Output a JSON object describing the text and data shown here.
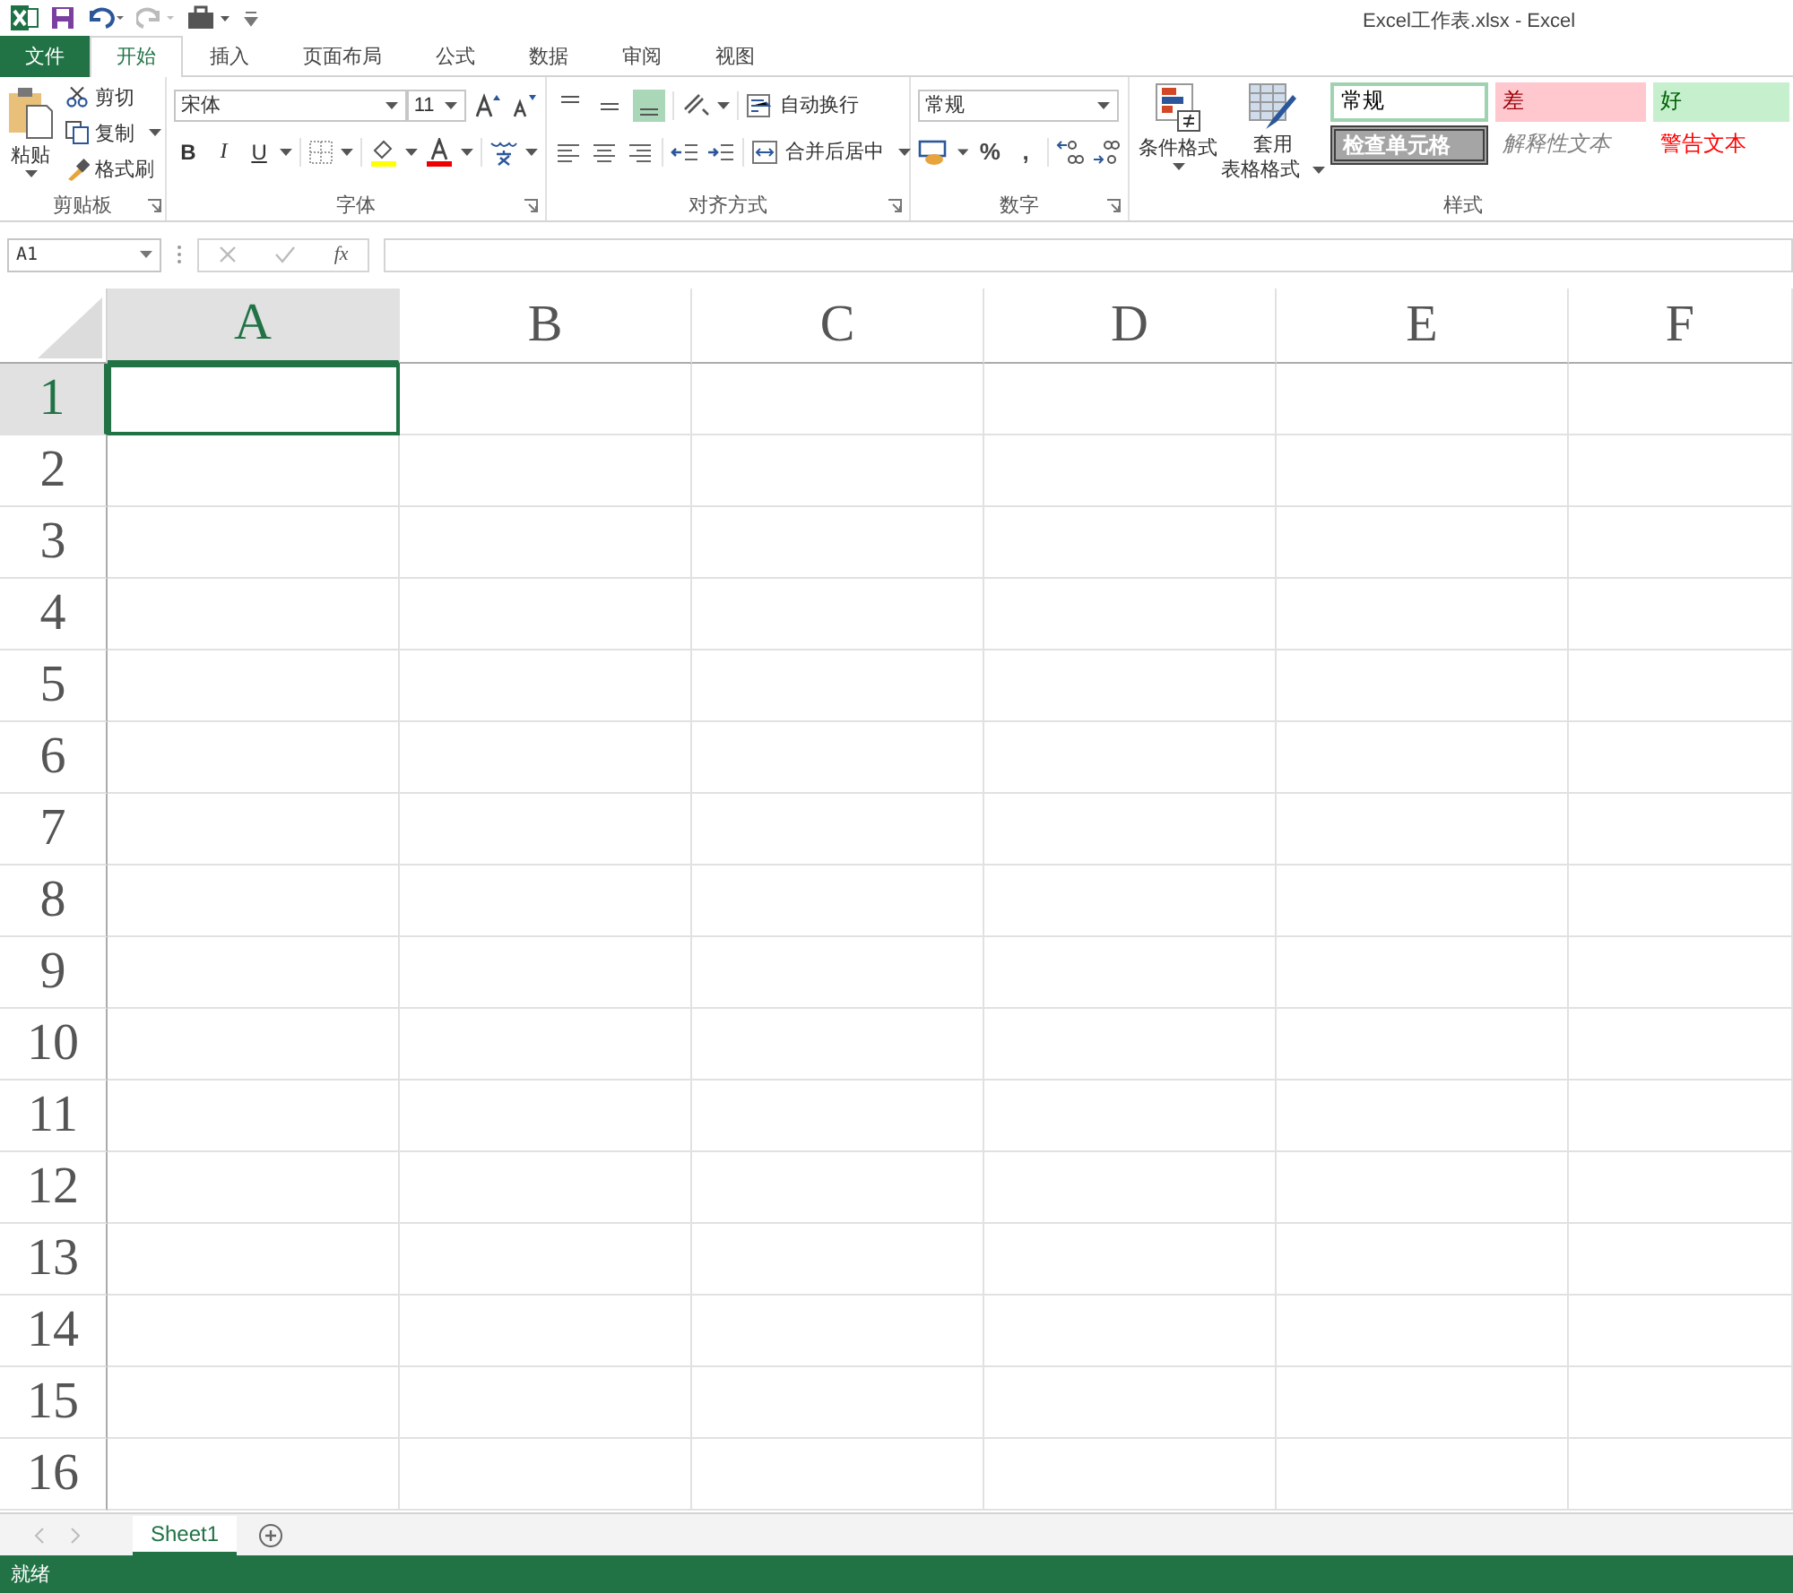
{
  "window": {
    "title": "Excel工作表.xlsx - Excel"
  },
  "tabs": [
    {
      "label": "文件",
      "kind": "file",
      "selected": false
    },
    {
      "label": "开始",
      "kind": "tab",
      "selected": true
    },
    {
      "label": "插入",
      "kind": "tab",
      "selected": false
    },
    {
      "label": "页面布局",
      "kind": "tab",
      "selected": false
    },
    {
      "label": "公式",
      "kind": "tab",
      "selected": false
    },
    {
      "label": "数据",
      "kind": "tab",
      "selected": false
    },
    {
      "label": "审阅",
      "kind": "tab",
      "selected": false
    },
    {
      "label": "视图",
      "kind": "tab",
      "selected": false
    }
  ],
  "clipboard": {
    "paste": "粘贴",
    "cut": "剪切",
    "copy": "复制",
    "format_painter": "格式刷",
    "label": "剪贴板"
  },
  "font": {
    "name": "宋体",
    "size": "11",
    "bold": "B",
    "italic": "I",
    "underline": "U",
    "label": "字体"
  },
  "alignment": {
    "vertical": [
      {
        "selected": false
      },
      {
        "selected": false
      },
      {
        "selected": true
      }
    ],
    "wrap_text": "自动换行",
    "merge_center": "合并后居中",
    "label": "对齐方式"
  },
  "number": {
    "format": "常规",
    "percent": "%",
    "comma": ",",
    "label": "数字"
  },
  "styles": {
    "conditional": "条件格式",
    "table_format": [
      "套用",
      "表格格式"
    ],
    "cells": [
      {
        "label": "常规",
        "kind": "normal"
      },
      {
        "label": "差",
        "kind": "bad"
      },
      {
        "label": "好",
        "kind": "good"
      },
      {
        "label": "检查单元格",
        "kind": "check"
      },
      {
        "label": "解释性文本",
        "kind": "explanatory"
      },
      {
        "label": "警告文本",
        "kind": "warning"
      }
    ],
    "label": "样式"
  },
  "formula_bar": {
    "name_box": "A1",
    "function_label": "fx"
  },
  "columns": [
    {
      "label": "A",
      "selected": true
    },
    {
      "label": "B",
      "selected": false
    },
    {
      "label": "C",
      "selected": false
    },
    {
      "label": "D",
      "selected": false
    },
    {
      "label": "E",
      "selected": false
    },
    {
      "label": "F",
      "selected": false
    }
  ],
  "rows": [
    {
      "label": "1",
      "selected": true
    },
    {
      "label": "2",
      "selected": false
    },
    {
      "label": "3",
      "selected": false
    },
    {
      "label": "4",
      "selected": false
    },
    {
      "label": "5",
      "selected": false
    },
    {
      "label": "6",
      "selected": false
    },
    {
      "label": "7",
      "selected": false
    },
    {
      "label": "8",
      "selected": false
    },
    {
      "label": "9",
      "selected": false
    },
    {
      "label": "10",
      "selected": false
    },
    {
      "label": "11",
      "selected": false
    },
    {
      "label": "12",
      "selected": false
    },
    {
      "label": "13",
      "selected": false
    },
    {
      "label": "14",
      "selected": false
    },
    {
      "label": "15",
      "selected": false
    },
    {
      "label": "16",
      "selected": false
    }
  ],
  "sheets": [
    {
      "label": "Sheet1",
      "selected": true
    }
  ],
  "status_bar": {
    "text": "就绪"
  }
}
